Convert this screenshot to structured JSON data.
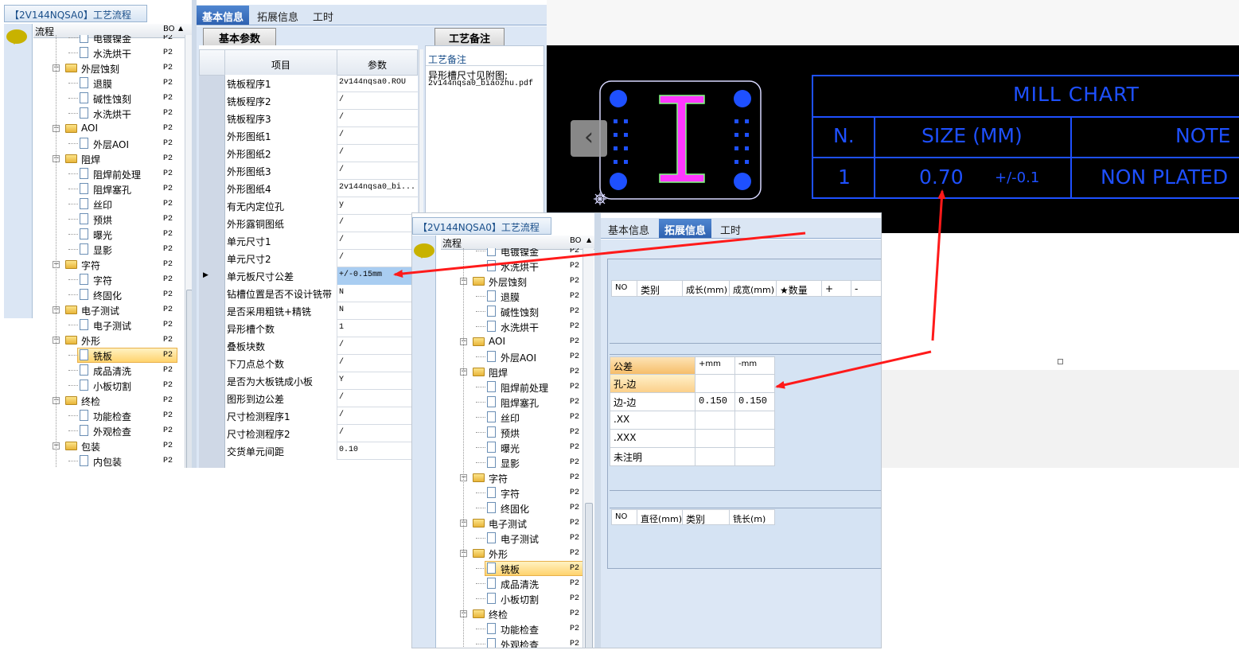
{
  "panel_left": {
    "title": "【2V144NQSA0】工艺流程",
    "tree_header": {
      "name": "流程",
      "code": "BO"
    },
    "tree": [
      {
        "label": "电镀镍金",
        "code": "P2",
        "type": "doc",
        "level": 2
      },
      {
        "label": "水洗烘干",
        "code": "P2",
        "type": "doc",
        "level": 2
      },
      {
        "label": "外层蚀刻",
        "code": "P2",
        "type": "folder",
        "level": 1
      },
      {
        "label": "退膜",
        "code": "P2",
        "type": "doc",
        "level": 2
      },
      {
        "label": "碱性蚀刻",
        "code": "P2",
        "type": "doc",
        "level": 2
      },
      {
        "label": "水洗烘干",
        "code": "P2",
        "type": "doc",
        "level": 2
      },
      {
        "label": "AOI",
        "code": "P2",
        "type": "folder",
        "level": 1
      },
      {
        "label": "外层AOI",
        "code": "P2",
        "type": "doc",
        "level": 2
      },
      {
        "label": "阻焊",
        "code": "P2",
        "type": "folder",
        "level": 1
      },
      {
        "label": "阻焊前处理",
        "code": "P2",
        "type": "doc",
        "level": 2
      },
      {
        "label": "阻焊塞孔",
        "code": "P2",
        "type": "doc",
        "level": 2
      },
      {
        "label": "丝印",
        "code": "P2",
        "type": "doc",
        "level": 2
      },
      {
        "label": "预烘",
        "code": "P2",
        "type": "doc",
        "level": 2
      },
      {
        "label": "曝光",
        "code": "P2",
        "type": "doc",
        "level": 2
      },
      {
        "label": "显影",
        "code": "P2",
        "type": "doc",
        "level": 2
      },
      {
        "label": "字符",
        "code": "P2",
        "type": "folder",
        "level": 1
      },
      {
        "label": "字符",
        "code": "P2",
        "type": "doc",
        "level": 2
      },
      {
        "label": "终固化",
        "code": "P2",
        "type": "doc",
        "level": 2
      },
      {
        "label": "电子测试",
        "code": "P2",
        "type": "folder",
        "level": 1
      },
      {
        "label": "电子测试",
        "code": "P2",
        "type": "doc",
        "level": 2
      },
      {
        "label": "外形",
        "code": "P2",
        "type": "folder",
        "level": 1
      },
      {
        "label": "铣板",
        "code": "P2",
        "type": "doc",
        "level": 2,
        "selected": true
      },
      {
        "label": "成品清洗",
        "code": "P2",
        "type": "doc",
        "level": 2
      },
      {
        "label": "小板切割",
        "code": "P2",
        "type": "doc",
        "level": 2
      },
      {
        "label": "终检",
        "code": "P2",
        "type": "folder",
        "level": 1
      },
      {
        "label": "功能检查",
        "code": "P2",
        "type": "doc",
        "level": 2
      },
      {
        "label": "外观检查",
        "code": "P2",
        "type": "doc",
        "level": 2
      },
      {
        "label": "包装",
        "code": "P2",
        "type": "folder",
        "level": 1
      },
      {
        "label": "内包装",
        "code": "P2",
        "type": "doc",
        "level": 2
      }
    ],
    "tabs": [
      "基本信息",
      "拓展信息",
      "工时"
    ],
    "active_tab": 0,
    "basic_params_tab": "基本参数",
    "process_note_tab": "工艺备注",
    "grid_headers": {
      "item": "项目",
      "param": "参数"
    },
    "params": [
      {
        "item": "铣板程序1",
        "value": "2v144nqsa0.ROU"
      },
      {
        "item": "铣板程序2",
        "value": "/"
      },
      {
        "item": "铣板程序3",
        "value": "/"
      },
      {
        "item": "外形图纸1",
        "value": "/"
      },
      {
        "item": "外形图纸2",
        "value": "/"
      },
      {
        "item": "外形图纸3",
        "value": "/"
      },
      {
        "item": "外形图纸4",
        "value": "2v144nqsa0_bi..."
      },
      {
        "item": "有无内定位孔",
        "value": "y"
      },
      {
        "item": "外形露铜图纸",
        "value": "/"
      },
      {
        "item": "单元尺寸1",
        "value": "/"
      },
      {
        "item": "单元尺寸2",
        "value": "/"
      },
      {
        "item": "单元板尺寸公差",
        "value": "+/-0.15mm",
        "selected": true
      },
      {
        "item": "钻槽位置是否不设计铣带",
        "value": "N"
      },
      {
        "item": "是否采用粗铣+精铣",
        "value": "N"
      },
      {
        "item": "异形槽个数",
        "value": "1"
      },
      {
        "item": "叠板块数",
        "value": "/"
      },
      {
        "item": "下刀点总个数",
        "value": "/"
      },
      {
        "item": "是否为大板铣成小板",
        "value": "Y"
      },
      {
        "item": "图形到边公差",
        "value": "/"
      },
      {
        "item": "尺寸检测程序1",
        "value": "/"
      },
      {
        "item": "尺寸检测程序2",
        "value": "/"
      },
      {
        "item": "交货单元间距",
        "value": "0.10"
      }
    ],
    "note": {
      "label": "工艺备注",
      "line1": "异形槽尺寸见附图:",
      "line2": "2v144nqsa0_biaozhu.pdf"
    }
  },
  "panel_right": {
    "title": "【2V144NQSA0】工艺流程",
    "tree_header": {
      "name": "流程",
      "code": "BO"
    },
    "tabs": [
      "基本信息",
      "拓展信息",
      "工时"
    ],
    "active_tab": 1,
    "top_table_headers": [
      "NO",
      "类别",
      "成长(mm)",
      "成宽(mm)",
      "★数量",
      "+",
      "-"
    ],
    "tolerance_headers": [
      "公差",
      "+mm",
      "-mm"
    ],
    "tolerance_rows": [
      {
        "label": "孔-边",
        "plus": "",
        "minus": "",
        "selected": true
      },
      {
        "label": "边-边",
        "plus": "0.150",
        "minus": "0.150"
      },
      {
        "label": ".XX",
        "plus": "",
        "minus": ""
      },
      {
        "label": ".XXX",
        "plus": "",
        "minus": ""
      },
      {
        "label": "未注明",
        "plus": "",
        "minus": ""
      }
    ],
    "bottom_table_headers": [
      "NO",
      "直径(mm)",
      "类别",
      "铣长(m)"
    ]
  },
  "cad": {
    "title": "MILL CHART",
    "col_n": "N.",
    "col_size": "SIZE (MM)",
    "col_note": "NOTE",
    "row_n": "1",
    "row_size": "0.70",
    "row_tol": "+/-0.1",
    "row_note": "NON PLATED",
    "colors": {
      "background": "#000000",
      "lines": "#1e50ff",
      "slot": "#ff38ff",
      "arrow": "#ff1a1a"
    }
  }
}
